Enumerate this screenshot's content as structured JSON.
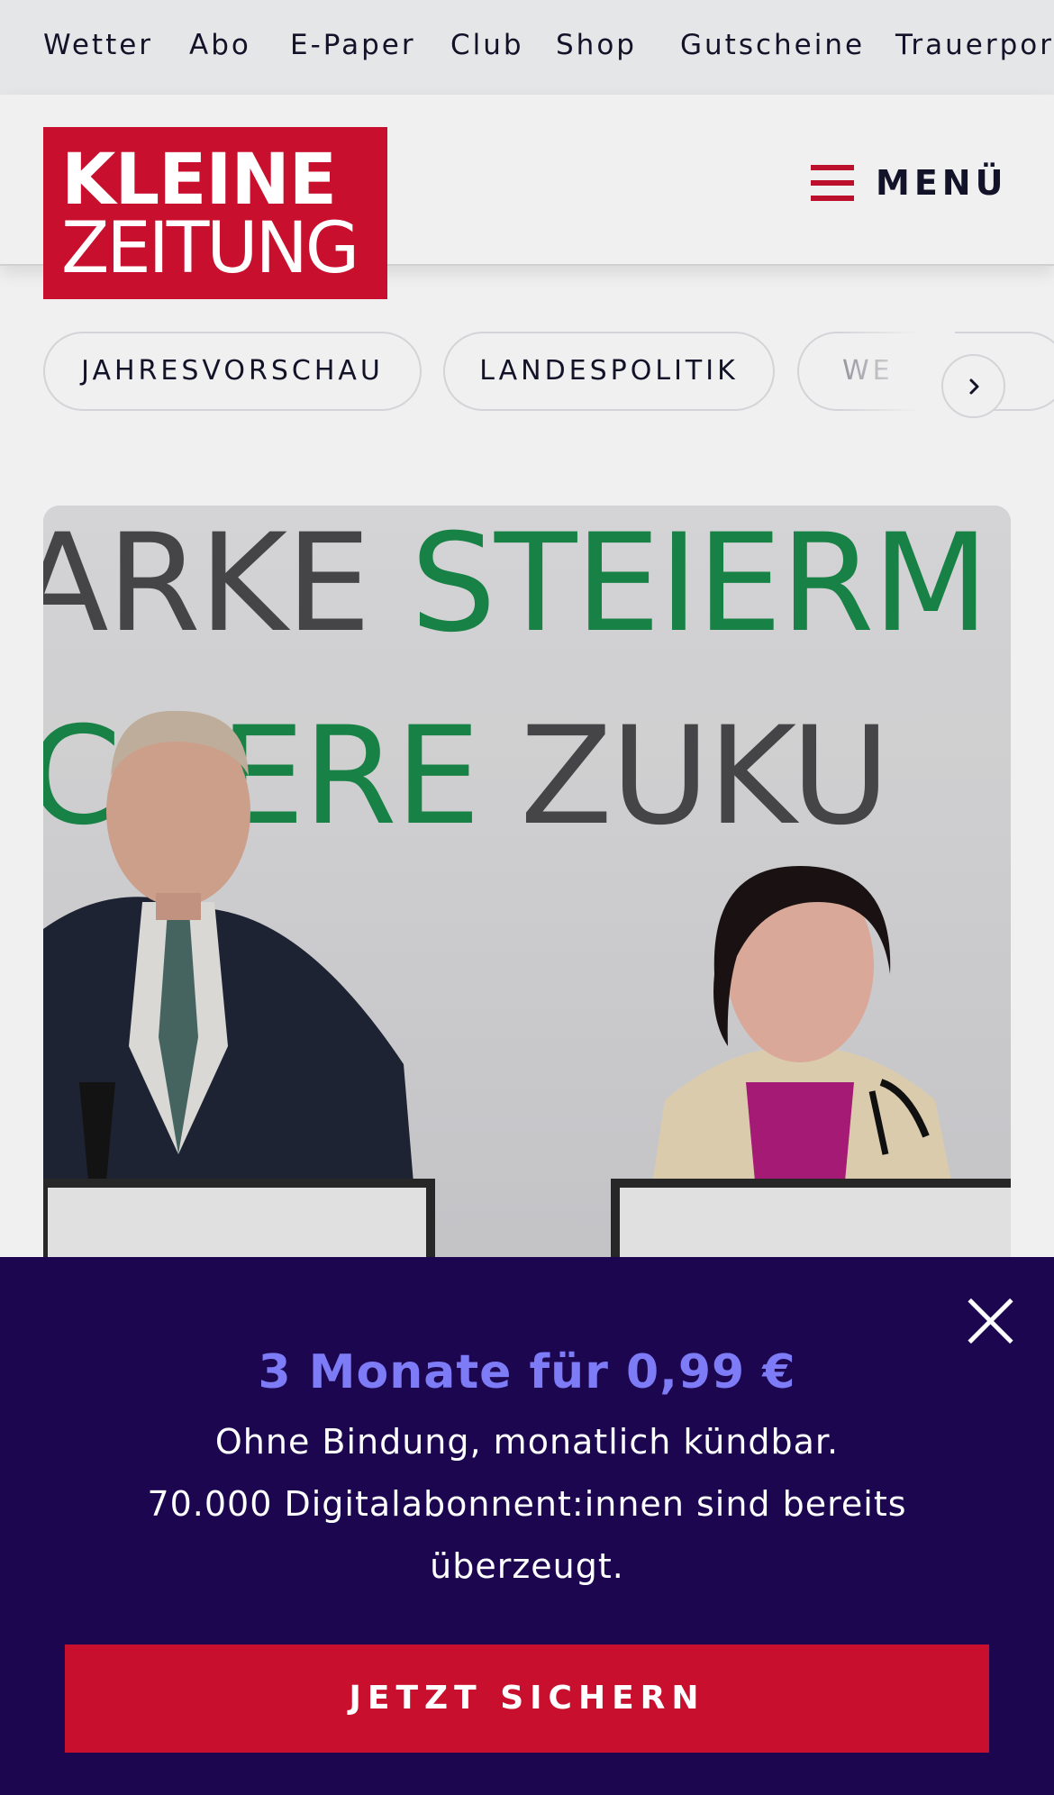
{
  "topnav": {
    "items": [
      "Wetter",
      "Abo",
      "E-Paper",
      "Club",
      "Shop",
      "Gutscheine",
      "Trauerportal"
    ]
  },
  "header": {
    "logo_line1": "KLEINE",
    "logo_line2": "ZEITUNG",
    "menu_label": "MENÜ"
  },
  "chips": {
    "items": [
      "JAHRESVORSCHAU",
      "LANDESPOLITIK",
      "WE"
    ]
  },
  "hero": {
    "backdrop_line1_gray": "ARKE ",
    "backdrop_line1_green": "STEIERM",
    "backdrop_line2_green": "ICHERE ",
    "backdrop_line2_gray": "ZUKU"
  },
  "banner": {
    "title": "3 Monate für 0,99 €",
    "line1": "Ohne Bindung, monatlich kündbar.",
    "line2": "70.000 Digitalabonnent:innen sind bereits",
    "line3": "überzeugt.",
    "cta": "JETZT SICHERN"
  },
  "colors": {
    "brand_red": "#c8102e",
    "banner_bg": "#1c0650",
    "banner_accent": "#7d7cf6",
    "backdrop_green": "#1a8a4a"
  },
  "icons": {
    "menu": "hamburger-icon",
    "next": "chevron-right-icon",
    "close": "close-icon"
  }
}
